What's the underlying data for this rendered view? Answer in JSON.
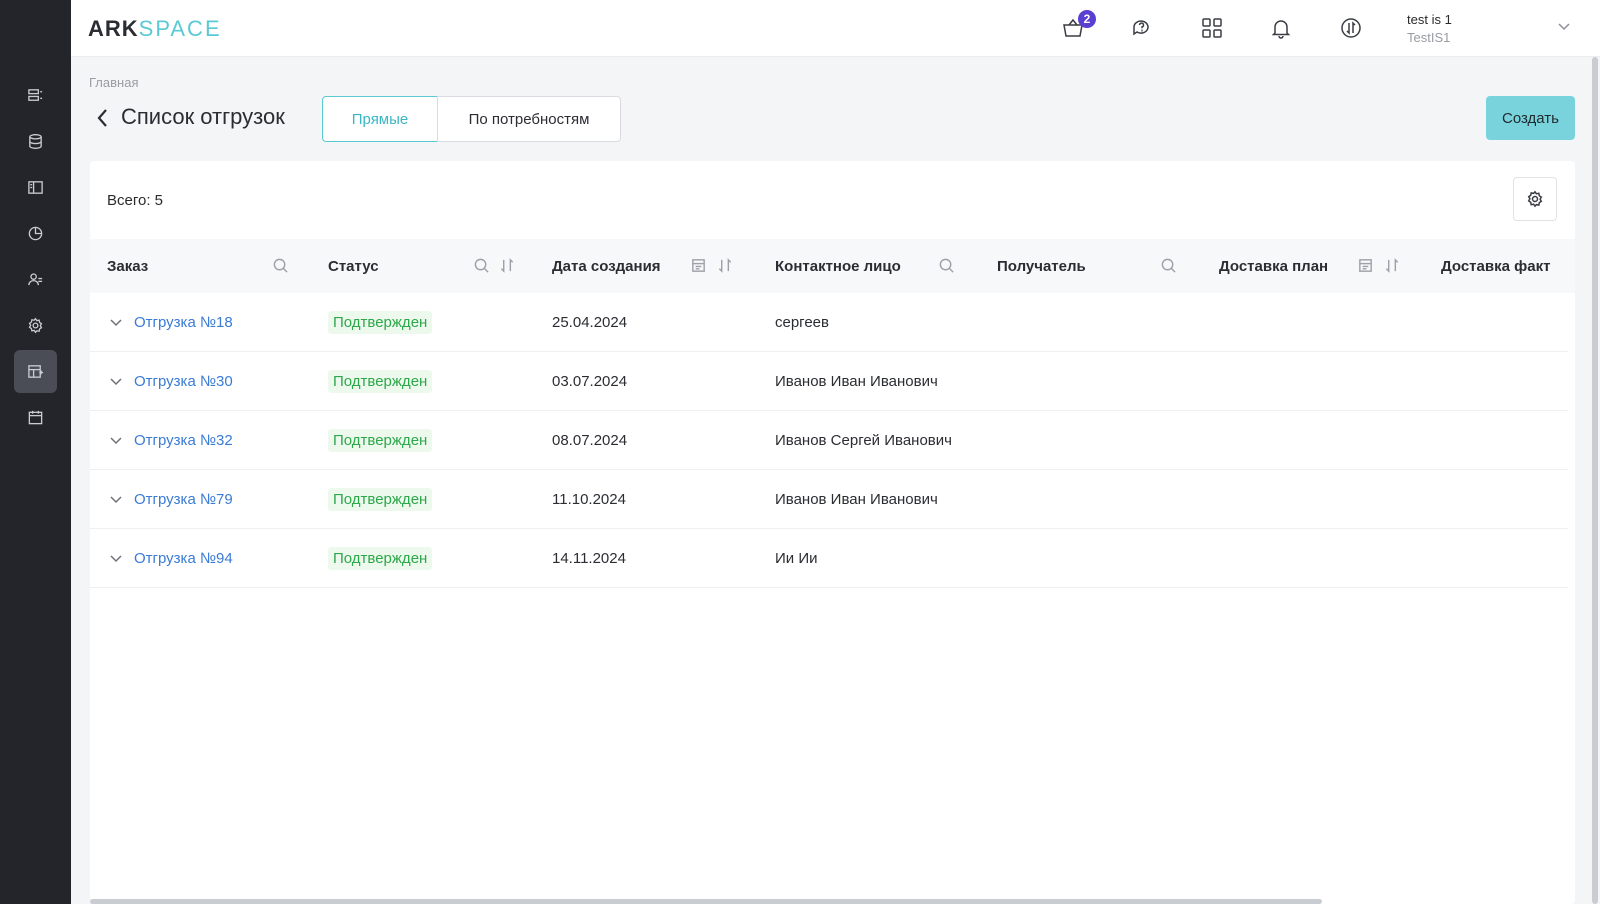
{
  "logo": {
    "part1": "ARK",
    "part2": "SPACE"
  },
  "header": {
    "cart_badge": "2",
    "user_name": "test is 1",
    "user_org": "TestIS1"
  },
  "sidebar": {
    "items": [
      {
        "icon": "orders-icon"
      },
      {
        "icon": "database-icon"
      },
      {
        "icon": "catalog-icon"
      },
      {
        "icon": "analytics-icon"
      },
      {
        "icon": "users-icon"
      },
      {
        "icon": "gear-icon"
      },
      {
        "icon": "shipments-icon",
        "active": true
      },
      {
        "icon": "calendar-icon"
      }
    ]
  },
  "breadcrumb": "Главная",
  "page_title": "Список отгрузок",
  "tabs": {
    "direct": "Прямые",
    "by_needs": "По потребностям"
  },
  "create_label": "Создать",
  "total_label": "Всего: 5",
  "columns": {
    "order": "Заказ",
    "status": "Статус",
    "created": "Дата создания",
    "contact": "Контактное лицо",
    "recipient": "Получатель",
    "delivery_plan": "Доставка план",
    "delivery_fact": "Доставка факт"
  },
  "rows": [
    {
      "order": "Отгрузка №18",
      "status": "Подтвержден",
      "created": "25.04.2024",
      "contact": "сергеев"
    },
    {
      "order": "Отгрузка №30",
      "status": "Подтвержден",
      "created": "03.07.2024",
      "contact": "Иванов Иван Иванович"
    },
    {
      "order": "Отгрузка №32",
      "status": "Подтвержден",
      "created": "08.07.2024",
      "contact": "Иванов Сергей Иванович"
    },
    {
      "order": "Отгрузка №79",
      "status": "Подтвержден",
      "created": "11.10.2024",
      "contact": "Иванов Иван Иванович"
    },
    {
      "order": "Отгрузка №94",
      "status": "Подтвержден",
      "created": "14.11.2024",
      "contact": "Ии Ии"
    }
  ]
}
